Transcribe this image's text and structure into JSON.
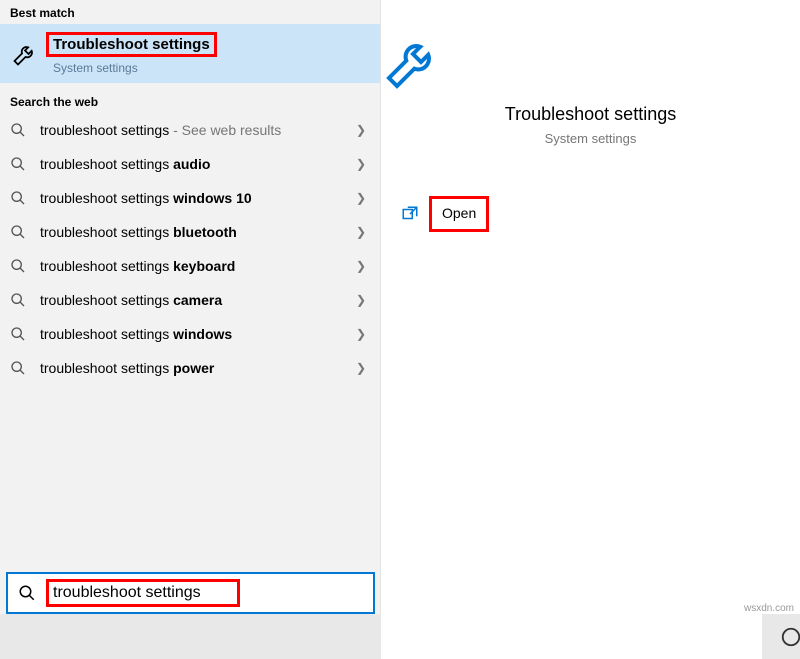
{
  "left": {
    "best_match_header": "Best match",
    "best_match": {
      "title": "Troubleshoot settings",
      "subtitle": "System settings"
    },
    "search_web_header": "Search the web",
    "web_results": [
      {
        "prefix": "troubleshoot settings",
        "suffix": "",
        "extra": " - See web results"
      },
      {
        "prefix": "troubleshoot settings ",
        "suffix": "audio",
        "extra": ""
      },
      {
        "prefix": "troubleshoot settings ",
        "suffix": "windows 10",
        "extra": ""
      },
      {
        "prefix": "troubleshoot settings ",
        "suffix": "bluetooth",
        "extra": ""
      },
      {
        "prefix": "troubleshoot settings ",
        "suffix": "keyboard",
        "extra": ""
      },
      {
        "prefix": "troubleshoot settings ",
        "suffix": "camera",
        "extra": ""
      },
      {
        "prefix": "troubleshoot settings ",
        "suffix": "windows",
        "extra": ""
      },
      {
        "prefix": "troubleshoot settings ",
        "suffix": "power",
        "extra": ""
      }
    ],
    "search_input": "troubleshoot settings"
  },
  "right": {
    "title": "Troubleshoot settings",
    "subtitle": "System settings",
    "open_label": "Open"
  },
  "watermark": "wsxdn.com",
  "colors": {
    "accent": "#0078d4",
    "highlight_bg": "#cce4f7",
    "red": "#ff0000"
  }
}
